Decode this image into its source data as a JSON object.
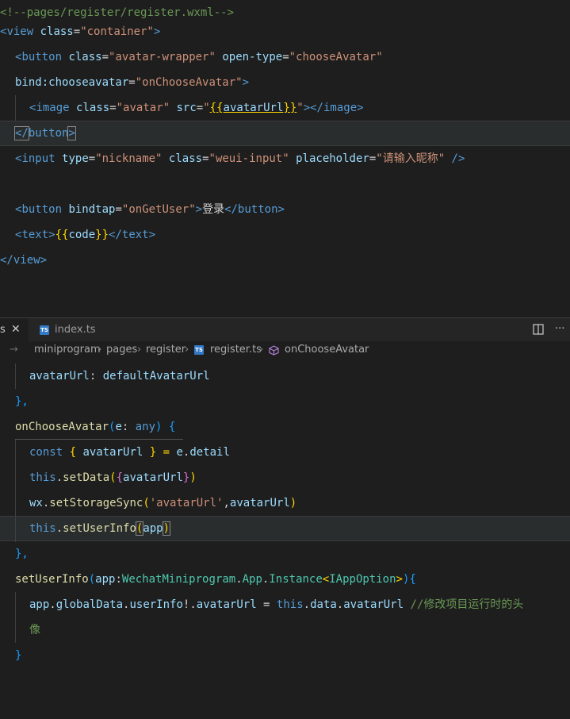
{
  "wxml": {
    "comment": "<!--pages/register/register.wxml-->",
    "view_open": [
      "<",
      "view",
      " ",
      "class",
      "=",
      "\"container\"",
      ">"
    ],
    "button_open_1": [
      "<",
      "button",
      " ",
      "class",
      "=",
      "\"avatar-wrapper\"",
      " ",
      "open-type",
      "=",
      "\"chooseAvatar\""
    ],
    "button_open_2": [
      "bind:chooseavatar",
      "=",
      "\"onChooseAvatar\"",
      ">"
    ],
    "image_line": [
      "<",
      "image",
      " ",
      "class",
      "=",
      "\"avatar\"",
      " ",
      "src",
      "=",
      "\"",
      "{{",
      "avatarUrl",
      "}}",
      "\"",
      "></",
      "image",
      ">"
    ],
    "button_close": [
      "</",
      "button",
      ">"
    ],
    "input_line": [
      "<",
      "input",
      " ",
      "type",
      "=",
      "\"nickname\"",
      " ",
      "class",
      "=",
      "\"weui-input\"",
      " ",
      "placeholder",
      "=",
      "\"请输入昵称\"",
      " />"
    ],
    "button_login": [
      "<",
      "button",
      " ",
      "bindtap",
      "=",
      "\"onGetUser\"",
      ">",
      "登录",
      "</",
      "button",
      ">"
    ],
    "text_line": [
      "<",
      "text",
      ">",
      "{{",
      "code",
      "}}",
      "</",
      "text",
      ">"
    ],
    "view_close": [
      "</",
      "view",
      ">"
    ]
  },
  "tabs": {
    "active_partial": "s",
    "close": "✕",
    "index_label": "index.ts",
    "ts_badge": "TS",
    "more": "···"
  },
  "breadcrumb": {
    "arrow": "→",
    "items": [
      "miniprogram",
      "pages",
      "register",
      "register.ts",
      "onChooseAvatar"
    ],
    "separator": "›"
  },
  "ts": {
    "l1": [
      "avatarUrl",
      ": ",
      "defaultAvatarUrl"
    ],
    "l2": "},",
    "l3": [
      "onChooseAvatar",
      "(",
      "e",
      ": ",
      "any",
      ") ",
      "{"
    ],
    "l4": [
      "const",
      " { ",
      "avatarUrl",
      " } = ",
      "e",
      ".",
      "detail"
    ],
    "l5": [
      "this",
      ".",
      "setData",
      "(",
      "{",
      "avatarUrl",
      "}",
      ")"
    ],
    "l6": [
      "wx",
      ".",
      "setStorageSync",
      "(",
      "'avatarUrl'",
      ",",
      "avatarUrl",
      ")"
    ],
    "l7": [
      "this",
      ".",
      "setUserInfo",
      "(",
      "app",
      ")"
    ],
    "l8": "},",
    "l9": [
      "setUserInfo",
      "(",
      "app",
      ":",
      "WechatMiniprogram",
      ".",
      "App",
      ".",
      "Instance",
      "<",
      "IAppOption",
      ">",
      ")",
      "{"
    ],
    "l10": [
      "app",
      ".",
      "globalData",
      ".",
      "userInfo",
      "!.",
      "avatarUrl",
      " = ",
      "this",
      ".",
      "data",
      ".",
      "avatarUrl",
      " ",
      "//修改项目运行时的头"
    ],
    "l11": "像",
    "l12": "}"
  },
  "colors": {
    "background": "#1e1e1e",
    "tag": "#569cd6",
    "attribute": "#9cdcfe",
    "string": "#ce9178",
    "comment": "#6a9955",
    "function": "#dcdcaa",
    "type": "#4ec9b0"
  }
}
